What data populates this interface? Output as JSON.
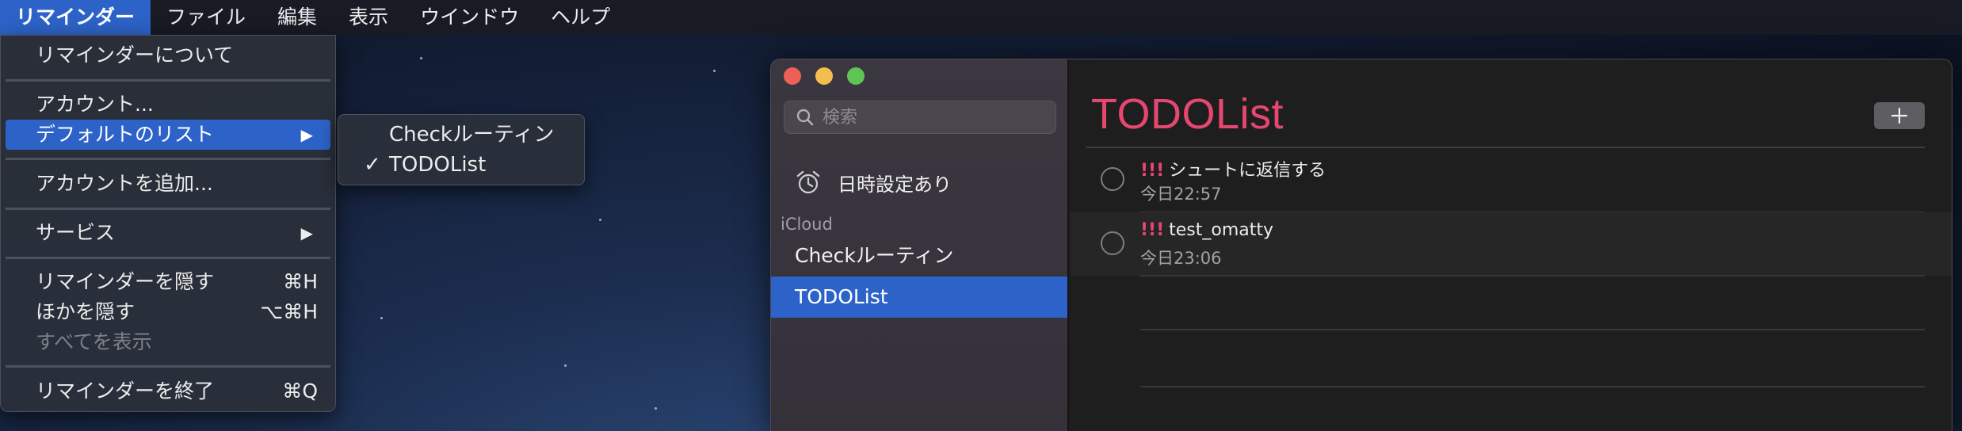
{
  "menubar": {
    "items": [
      "リマインダー",
      "ファイル",
      "編集",
      "表示",
      "ウインドウ",
      "ヘルプ"
    ]
  },
  "app_menu": {
    "about": "リマインダーについて",
    "accounts": "アカウント...",
    "default_list": "デフォルトのリスト",
    "add_account": "アカウントを追加...",
    "services": "サービス",
    "hide": "リマインダーを隠す",
    "hide_shortcut": "⌘H",
    "hide_others": "ほかを隠す",
    "hide_others_shortcut": "⌥⌘H",
    "show_all": "すべてを表示",
    "quit": "リマインダーを終了",
    "quit_shortcut": "⌘Q",
    "submenu_arrow": "▶"
  },
  "default_list_submenu": {
    "items": [
      {
        "label": "Checkルーティン",
        "checked": false
      },
      {
        "label": "TODOList",
        "checked": true
      }
    ],
    "check_mark": "✓"
  },
  "sidebar": {
    "search_placeholder": "検索",
    "smart_list": "日時設定あり",
    "section": "iCloud",
    "lists": [
      {
        "label": "Checkルーティン",
        "selected": false
      },
      {
        "label": "TODOList",
        "selected": true
      }
    ]
  },
  "main": {
    "title": "TODOList",
    "tasks": [
      {
        "priority": "!!!",
        "name": "シュートに返信する",
        "due": "今日22:57"
      },
      {
        "priority": "!!!",
        "name": "test_omatty",
        "due": "今日23:06"
      }
    ]
  },
  "colors": {
    "accent": "#2d63c8",
    "title": "#e6476f",
    "priority": "#e6476f"
  }
}
